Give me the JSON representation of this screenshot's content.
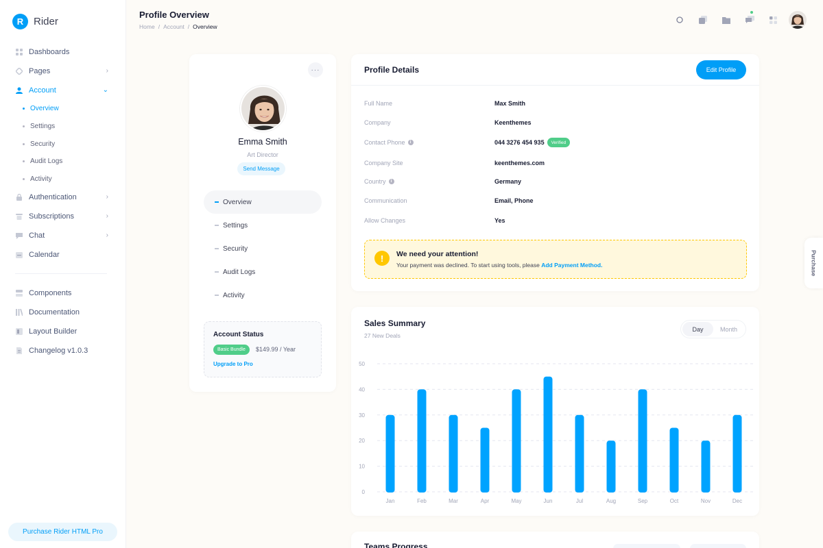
{
  "brand": {
    "logo_letter": "R",
    "name": "Rider"
  },
  "sidebar": {
    "menu": [
      {
        "label": "Dashboards",
        "icon": "grid-icon",
        "has_chevron": false
      },
      {
        "label": "Pages",
        "icon": "pages-icon",
        "has_chevron": true
      },
      {
        "label": "Account",
        "icon": "user-icon",
        "has_chevron": true,
        "active": true
      },
      {
        "label": "Authentication",
        "icon": "lock-icon",
        "has_chevron": true
      },
      {
        "label": "Subscriptions",
        "icon": "subscriptions-icon",
        "has_chevron": true
      },
      {
        "label": "Chat",
        "icon": "chat-icon",
        "has_chevron": true
      },
      {
        "label": "Calendar",
        "icon": "calendar-icon",
        "has_chevron": false
      },
      {
        "label": "Components",
        "icon": "components-icon"
      },
      {
        "label": "Documentation",
        "icon": "documentation-icon"
      },
      {
        "label": "Layout Builder",
        "icon": "layout-icon"
      },
      {
        "label": "Changelog v1.0.3",
        "icon": "changelog-icon"
      }
    ],
    "account_sub": [
      {
        "label": "Overview",
        "active": true
      },
      {
        "label": "Settings"
      },
      {
        "label": "Security"
      },
      {
        "label": "Audit Logs"
      },
      {
        "label": "Activity"
      }
    ],
    "purchase_label": "Purchase Rider HTML Pro"
  },
  "header": {
    "title": "Profile Overview",
    "breadcrumb": [
      "Home",
      "Account",
      "Overview"
    ],
    "separator": "/"
  },
  "profile": {
    "more_label": "···",
    "name": "Emma Smith",
    "role": "Art Director",
    "send_message": "Send Message",
    "nav": [
      {
        "label": "Overview",
        "active": true
      },
      {
        "label": "Settings"
      },
      {
        "label": "Security"
      },
      {
        "label": "Audit Logs"
      },
      {
        "label": "Activity"
      }
    ],
    "account_status": {
      "title": "Account Status",
      "badge": "Basic Bundle",
      "price": "$149.99 / Year",
      "upgrade": "Upgrade to Pro"
    }
  },
  "details": {
    "title": "Profile Details",
    "edit_label": "Edit Profile",
    "rows": [
      {
        "label": "Full Name",
        "value": "Max Smith"
      },
      {
        "label": "Company",
        "value": "Keenthemes"
      },
      {
        "label": "Contact Phone",
        "value": "044 3276 454 935",
        "badge": "Verified",
        "info": true
      },
      {
        "label": "Company Site",
        "value": "keenthemes.com"
      },
      {
        "label": "Country",
        "value": "Germany",
        "info": true
      },
      {
        "label": "Communication",
        "value": "Email, Phone"
      },
      {
        "label": "Allow Changes",
        "value": "Yes"
      }
    ],
    "notice": {
      "icon": "!",
      "title": "We need your attention!",
      "text": "Your payment was declined. To start using tools, please ",
      "link": "Add Payment Method",
      "text_end": "."
    }
  },
  "sales": {
    "title": "Sales Summary",
    "subtitle": "27 New Deals",
    "toggle": [
      {
        "label": "Day",
        "active": true
      },
      {
        "label": "Month",
        "active": false
      }
    ]
  },
  "chart_data": {
    "type": "bar",
    "categories": [
      "Jan",
      "Feb",
      "Mar",
      "Apr",
      "May",
      "Jun",
      "Jul",
      "Aug",
      "Sep",
      "Oct",
      "Nov",
      "Dec"
    ],
    "values": [
      30,
      40,
      30,
      25,
      40,
      45,
      30,
      20,
      40,
      25,
      20,
      30
    ],
    "ylim": [
      0,
      50
    ],
    "yticks": [
      0,
      10,
      20,
      30,
      40,
      50
    ],
    "color": "#00a3ff",
    "grid": true
  },
  "teams": {
    "title": "Teams Progress"
  },
  "float_tab": {
    "label": "Purchase"
  },
  "colors": {
    "primary": "#009ef7",
    "success": "#50cd89",
    "warning": "#ffc700"
  }
}
